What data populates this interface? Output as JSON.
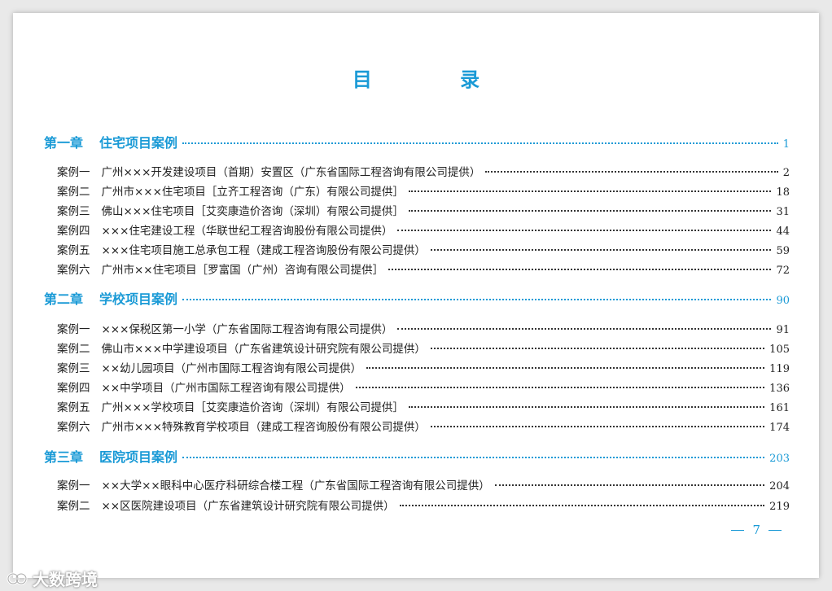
{
  "title": "目  录",
  "chapters": [
    {
      "num": "第一章",
      "name": "住宅项目案例",
      "page": "1",
      "cases": [
        {
          "num": "案例一",
          "text": "广州×××开发建设项目（首期）安置区（广东省国际工程咨询有限公司提供）",
          "page": "2"
        },
        {
          "num": "案例二",
          "text": "广州市×××住宅项目［立齐工程咨询（广东）有限公司提供］",
          "page": "18"
        },
        {
          "num": "案例三",
          "text": "佛山×××住宅项目［艾奕康造价咨询（深圳）有限公司提供］",
          "page": "31"
        },
        {
          "num": "案例四",
          "text": "×××住宅建设工程（华联世纪工程咨询股份有限公司提供）",
          "page": "44"
        },
        {
          "num": "案例五",
          "text": "×××住宅项目施工总承包工程（建成工程咨询股份有限公司提供）",
          "page": "59"
        },
        {
          "num": "案例六",
          "text": "广州市××住宅项目［罗富国（广州）咨询有限公司提供］",
          "page": "72"
        }
      ]
    },
    {
      "num": "第二章",
      "name": "学校项目案例",
      "page": "90",
      "cases": [
        {
          "num": "案例一",
          "text": "×××保税区第一小学（广东省国际工程咨询有限公司提供）",
          "page": "91"
        },
        {
          "num": "案例二",
          "text": "佛山市×××中学建设项目（广东省建筑设计研究院有限公司提供）",
          "page": "105"
        },
        {
          "num": "案例三",
          "text": "××幼儿园项目（广州市国际工程咨询有限公司提供）",
          "page": "119"
        },
        {
          "num": "案例四",
          "text": "××中学项目（广州市国际工程咨询有限公司提供）",
          "page": "136"
        },
        {
          "num": "案例五",
          "text": "广州×××学校项目［艾奕康造价咨询（深圳）有限公司提供］",
          "page": "161"
        },
        {
          "num": "案例六",
          "text": "广州市×××特殊教育学校项目（建成工程咨询股份有限公司提供）",
          "page": "174"
        }
      ]
    },
    {
      "num": "第三章",
      "name": "医院项目案例",
      "page": "203",
      "cases": [
        {
          "num": "案例一",
          "text": "××大学××眼科中心医疗科研综合楼工程（广东省国际工程咨询有限公司提供）",
          "page": "204"
        },
        {
          "num": "案例二",
          "text": "××区医院建设项目（广东省建筑设计研究院有限公司提供）",
          "page": "219"
        }
      ]
    }
  ],
  "page_number": "7",
  "watermark": "大数跨境",
  "colors": {
    "accent": "#1a9ad6",
    "text": "#222222"
  }
}
